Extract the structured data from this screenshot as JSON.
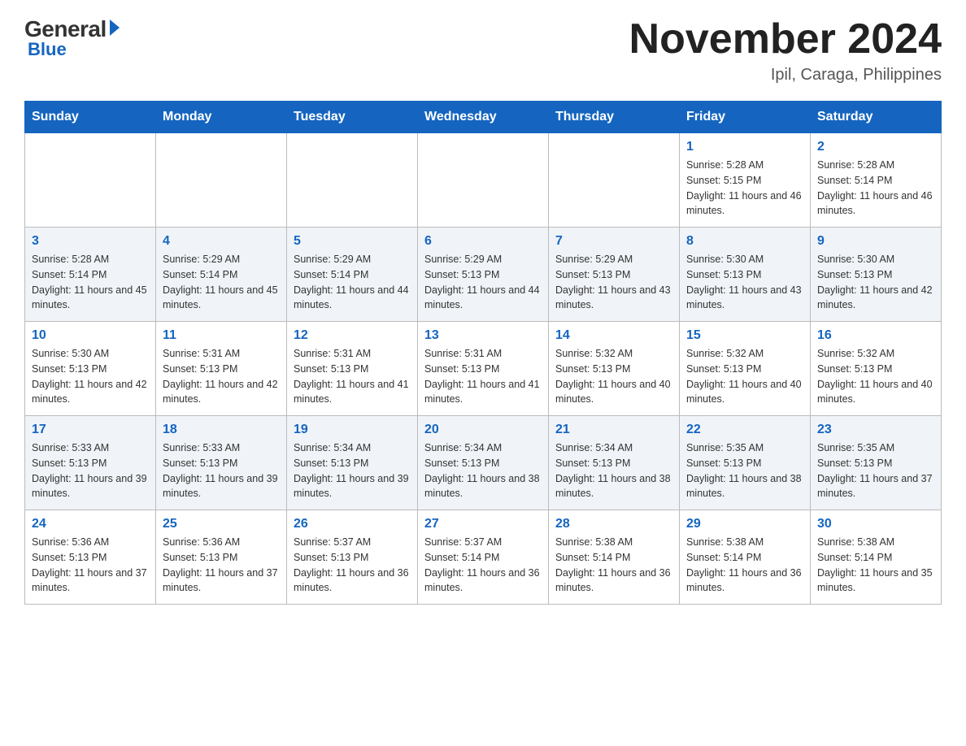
{
  "header": {
    "logo": {
      "general": "General",
      "blue": "Blue"
    },
    "title": "November 2024",
    "location": "Ipil, Caraga, Philippines"
  },
  "weekdays": [
    "Sunday",
    "Monday",
    "Tuesday",
    "Wednesday",
    "Thursday",
    "Friday",
    "Saturday"
  ],
  "weeks": [
    [
      {
        "day": null
      },
      {
        "day": null
      },
      {
        "day": null
      },
      {
        "day": null
      },
      {
        "day": null
      },
      {
        "day": "1",
        "sunrise": "5:28 AM",
        "sunset": "5:15 PM",
        "daylight": "11 hours and 46 minutes."
      },
      {
        "day": "2",
        "sunrise": "5:28 AM",
        "sunset": "5:14 PM",
        "daylight": "11 hours and 46 minutes."
      }
    ],
    [
      {
        "day": "3",
        "sunrise": "5:28 AM",
        "sunset": "5:14 PM",
        "daylight": "11 hours and 45 minutes."
      },
      {
        "day": "4",
        "sunrise": "5:29 AM",
        "sunset": "5:14 PM",
        "daylight": "11 hours and 45 minutes."
      },
      {
        "day": "5",
        "sunrise": "5:29 AM",
        "sunset": "5:14 PM",
        "daylight": "11 hours and 44 minutes."
      },
      {
        "day": "6",
        "sunrise": "5:29 AM",
        "sunset": "5:13 PM",
        "daylight": "11 hours and 44 minutes."
      },
      {
        "day": "7",
        "sunrise": "5:29 AM",
        "sunset": "5:13 PM",
        "daylight": "11 hours and 43 minutes."
      },
      {
        "day": "8",
        "sunrise": "5:30 AM",
        "sunset": "5:13 PM",
        "daylight": "11 hours and 43 minutes."
      },
      {
        "day": "9",
        "sunrise": "5:30 AM",
        "sunset": "5:13 PM",
        "daylight": "11 hours and 42 minutes."
      }
    ],
    [
      {
        "day": "10",
        "sunrise": "5:30 AM",
        "sunset": "5:13 PM",
        "daylight": "11 hours and 42 minutes."
      },
      {
        "day": "11",
        "sunrise": "5:31 AM",
        "sunset": "5:13 PM",
        "daylight": "11 hours and 42 minutes."
      },
      {
        "day": "12",
        "sunrise": "5:31 AM",
        "sunset": "5:13 PM",
        "daylight": "11 hours and 41 minutes."
      },
      {
        "day": "13",
        "sunrise": "5:31 AM",
        "sunset": "5:13 PM",
        "daylight": "11 hours and 41 minutes."
      },
      {
        "day": "14",
        "sunrise": "5:32 AM",
        "sunset": "5:13 PM",
        "daylight": "11 hours and 40 minutes."
      },
      {
        "day": "15",
        "sunrise": "5:32 AM",
        "sunset": "5:13 PM",
        "daylight": "11 hours and 40 minutes."
      },
      {
        "day": "16",
        "sunrise": "5:32 AM",
        "sunset": "5:13 PM",
        "daylight": "11 hours and 40 minutes."
      }
    ],
    [
      {
        "day": "17",
        "sunrise": "5:33 AM",
        "sunset": "5:13 PM",
        "daylight": "11 hours and 39 minutes."
      },
      {
        "day": "18",
        "sunrise": "5:33 AM",
        "sunset": "5:13 PM",
        "daylight": "11 hours and 39 minutes."
      },
      {
        "day": "19",
        "sunrise": "5:34 AM",
        "sunset": "5:13 PM",
        "daylight": "11 hours and 39 minutes."
      },
      {
        "day": "20",
        "sunrise": "5:34 AM",
        "sunset": "5:13 PM",
        "daylight": "11 hours and 38 minutes."
      },
      {
        "day": "21",
        "sunrise": "5:34 AM",
        "sunset": "5:13 PM",
        "daylight": "11 hours and 38 minutes."
      },
      {
        "day": "22",
        "sunrise": "5:35 AM",
        "sunset": "5:13 PM",
        "daylight": "11 hours and 38 minutes."
      },
      {
        "day": "23",
        "sunrise": "5:35 AM",
        "sunset": "5:13 PM",
        "daylight": "11 hours and 37 minutes."
      }
    ],
    [
      {
        "day": "24",
        "sunrise": "5:36 AM",
        "sunset": "5:13 PM",
        "daylight": "11 hours and 37 minutes."
      },
      {
        "day": "25",
        "sunrise": "5:36 AM",
        "sunset": "5:13 PM",
        "daylight": "11 hours and 37 minutes."
      },
      {
        "day": "26",
        "sunrise": "5:37 AM",
        "sunset": "5:13 PM",
        "daylight": "11 hours and 36 minutes."
      },
      {
        "day": "27",
        "sunrise": "5:37 AM",
        "sunset": "5:14 PM",
        "daylight": "11 hours and 36 minutes."
      },
      {
        "day": "28",
        "sunrise": "5:38 AM",
        "sunset": "5:14 PM",
        "daylight": "11 hours and 36 minutes."
      },
      {
        "day": "29",
        "sunrise": "5:38 AM",
        "sunset": "5:14 PM",
        "daylight": "11 hours and 36 minutes."
      },
      {
        "day": "30",
        "sunrise": "5:38 AM",
        "sunset": "5:14 PM",
        "daylight": "11 hours and 35 minutes."
      }
    ]
  ],
  "labels": {
    "sunrise": "Sunrise:",
    "sunset": "Sunset:",
    "daylight": "Daylight:"
  }
}
